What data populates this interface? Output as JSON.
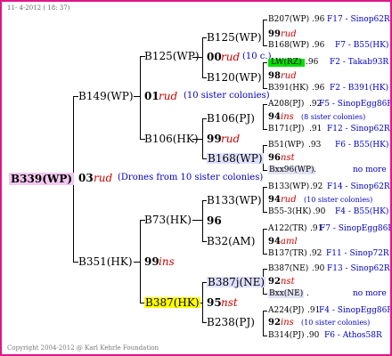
{
  "header_date": "11- 4-2012 ( 18: 37)",
  "footer": "Copyright 2004-2012 @ Karl Kehrle Foundation",
  "colors": {
    "frame_border": "#e0158b",
    "red_text": "#cc0000",
    "blue_text": "#0000c0"
  },
  "root": {
    "id": "B339(WP)",
    "year": "03",
    "breed": "rud",
    "note": "(Drones from 10 sister colonies)"
  },
  "sire": {
    "id": "B149(WP)",
    "year": "01",
    "breed": "rud",
    "note": "(10 sister colonies)"
  },
  "dam": {
    "id": "B351(HK)",
    "year": "99",
    "breed": "ins"
  },
  "g3": {
    "a": {
      "id": "B125(WP)",
      "year": "00",
      "breed": "rud",
      "note": "(10 c.)"
    },
    "b": {
      "id": "B106(HK)",
      "year": "99",
      "breed": "rud"
    },
    "c": {
      "id": "B73(HK)",
      "year": "96",
      "breed": ""
    },
    "d": {
      "id": "B387(HK)",
      "year": "95",
      "breed": "nst"
    }
  },
  "g4": {
    "a1": {
      "id": "B125(WP)"
    },
    "a2": {
      "id": "B120(WP)"
    },
    "b1": {
      "id": "B106(PJ)",
      "year": "94",
      "breed": "ins",
      "note": "(8 sister colonies)"
    },
    "b2": {
      "id": "B168(WP)",
      "year": "96",
      "breed": "nst"
    },
    "c1": {
      "id": "B133(WP)",
      "year": "94",
      "breed": "rud",
      "note": "(10 sister colonies)"
    },
    "c2": {
      "id": "B32(AM)",
      "year": "94",
      "breed": "aml"
    },
    "d1": {
      "id": "B387j(NE)",
      "year": "92",
      "breed": "nst"
    },
    "d2": {
      "id": "B238(PJ)",
      "year": "92",
      "breed": "ins",
      "note": "(10 sister colonies)"
    }
  },
  "g5": [
    {
      "id": "B207(WP)",
      "ver": ".96",
      "right": "F17 - Sinop62R"
    },
    {
      "year": "99",
      "breed": "rud"
    },
    {
      "id": "B168(WP)",
      "ver": ".96",
      "right": "F7 - B55(HK)"
    },
    {
      "id": "LW(RZ)",
      "ver": ".96",
      "right": "F2 - Takab93R"
    },
    {
      "year": "98",
      "breed": "rud"
    },
    {
      "id": "B391(HK)",
      "ver": ".96",
      "right": "F2 - B391(HK)"
    },
    {
      "id": "A208(PJ)",
      "ver": ".92",
      "right": "F5 - SinopEgg86R"
    },
    {
      "id": "B171(PJ)",
      "ver": ".91",
      "right": "F12 - Sinop62R"
    },
    {
      "id": "B51(WP)",
      "ver": ".93",
      "right": "F6 - B55(HK)"
    },
    {
      "id": "Bxx96(WP)",
      "ver": ".",
      "right": "no more"
    },
    {
      "id": "B133(WP)",
      "ver": ".92",
      "right": "F14 - Sinop62R"
    },
    {
      "id": "B55-3(HK)",
      "ver": ".90",
      "right": "F4 - B55(HK)"
    },
    {
      "id": "A122(TR)",
      "ver": ".91",
      "right": "F7 - SinopEgg86R"
    },
    {
      "id": "B137(TR)",
      "ver": ".92",
      "right": "F11 - Sinop72R"
    },
    {
      "id": "B387(NE)",
      "ver": ".90",
      "right": "F13 - Sinop62R"
    },
    {
      "id": "Bxx(NE)",
      "ver": ".",
      "right": "no more"
    },
    {
      "id": "A224(PJ)",
      "ver": ".91",
      "right": "F4 - SinopEgg86R"
    },
    {
      "id": "B314(PJ)",
      "ver": ".90",
      "right": "F6 - Athos58R"
    }
  ]
}
